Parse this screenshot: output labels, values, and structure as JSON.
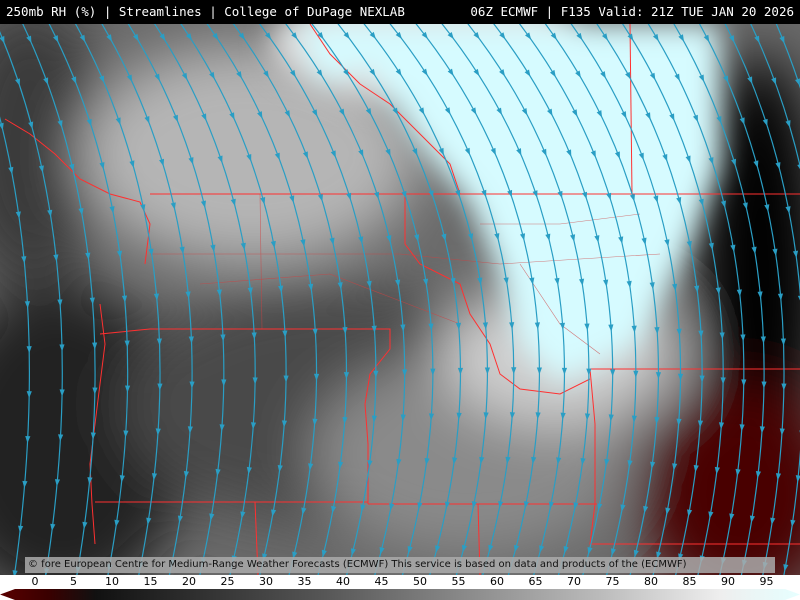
{
  "header": {
    "left_title": "250mb RH (%) | Streamlines | College of DuPage NEXLAB",
    "right_title": "06Z ECMWF | F135 Valid: 21Z TUE JAN 20 2026"
  },
  "credit": "© fore European Centre for Medium-Range Weather Forecasts (ECMWF)  This service is based on data and products of the (ECMWF)",
  "colorbar": {
    "ticks": [
      "0",
      "5",
      "10",
      "15",
      "20",
      "25",
      "30",
      "35",
      "40",
      "45",
      "50",
      "55",
      "60",
      "65",
      "70",
      "75",
      "80",
      "85",
      "90",
      "95"
    ],
    "colors": {
      "dry": "#5a0000",
      "mid_dark": "#2a2a2a",
      "mid_light": "#d8d8d8",
      "moist": "#e6ffff"
    }
  },
  "map": {
    "streamline_color": "#2a9ec4",
    "border_color": "#ff3030"
  }
}
